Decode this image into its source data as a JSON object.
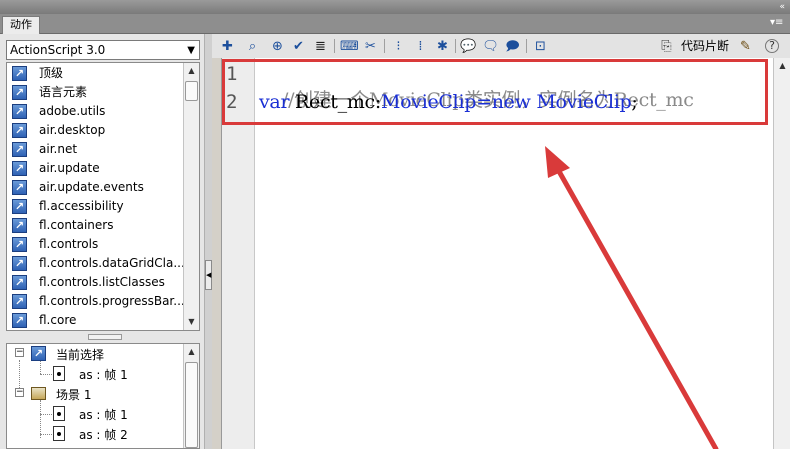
{
  "panel": {
    "tab_label": "动作",
    "double_arrow": "«",
    "menu_icon": "▾≡"
  },
  "left": {
    "dropdown_value": "ActionScript 3.0",
    "items": [
      {
        "label": "顶级"
      },
      {
        "label": "语言元素"
      },
      {
        "label": "adobe.utils"
      },
      {
        "label": "air.desktop"
      },
      {
        "label": "air.net"
      },
      {
        "label": "air.update"
      },
      {
        "label": "air.update.events"
      },
      {
        "label": "fl.accessibility"
      },
      {
        "label": "fl.containers"
      },
      {
        "label": "fl.controls"
      },
      {
        "label": "fl.controls.dataGridCla..."
      },
      {
        "label": "fl.controls.listClasses"
      },
      {
        "label": "fl.controls.progressBar..."
      },
      {
        "label": "fl.core"
      }
    ]
  },
  "tree": {
    "current": "当前选择",
    "current_frame": "as : 帧 1",
    "scene": "场景 1",
    "scene_frames": [
      "as : 帧 1",
      "as : 帧 2"
    ]
  },
  "toolbar": {
    "snippets_label": "代码片断",
    "help": "?"
  },
  "editor": {
    "lines": [
      {
        "no": "1",
        "comment": "//创建一个MovieClip类实例，实例名为Rect_mc"
      },
      {
        "no": "2",
        "kw_var": "var",
        "name": " Rect_mc:",
        "type": "MovieClip",
        "eq": "=",
        "kw_new": "new",
        "ctor": " MovieClip",
        "end": ";"
      }
    ]
  },
  "colors": {
    "highlight": "#d93a3a",
    "keyword": "#1a2fd4",
    "comment": "#8a8a8a"
  }
}
